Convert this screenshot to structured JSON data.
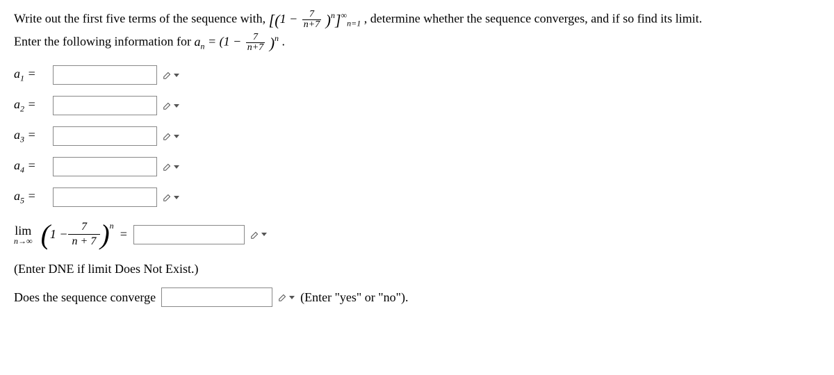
{
  "intro": {
    "line1_a": "Write out the first five terms of the sequence with, ",
    "seq_open": "[(1 − ",
    "frac_num": "7",
    "frac_den_a": "n",
    "frac_den_b": "+7",
    "seq_close": ")",
    "seq_exp": "n",
    "seq_bracket_close": "]",
    "inf": "∞",
    "n_eq_1": "n=1",
    "line1_b": ", determine whether the sequence converges, and if so find its limit.",
    "line2_a": "Enter the following information for ",
    "a_n": "a",
    "a_n_sub": "n",
    "eq": " = (1 − ",
    "line2_exp": "n",
    "line2_end": "."
  },
  "terms": [
    {
      "label_a": "a",
      "label_sub": "1",
      "label_eq": " ="
    },
    {
      "label_a": "a",
      "label_sub": "2",
      "label_eq": " ="
    },
    {
      "label_a": "a",
      "label_sub": "3",
      "label_eq": " ="
    },
    {
      "label_a": "a",
      "label_sub": "4",
      "label_eq": " ="
    },
    {
      "label_a": "a",
      "label_sub": "5",
      "label_eq": " ="
    }
  ],
  "limit": {
    "lim": "lim",
    "n_inf": "n→∞",
    "paren_open": "(",
    "one_minus": "1 − ",
    "frac_num": "7",
    "frac_den": "n + 7",
    "paren_close": ")",
    "exp": "n",
    "eq": " ="
  },
  "note_dne": "(Enter DNE if limit Does Not Exist.)",
  "converge": {
    "q": "Does the sequence converge",
    "hint": "(Enter \"yes\" or \"no\")."
  }
}
